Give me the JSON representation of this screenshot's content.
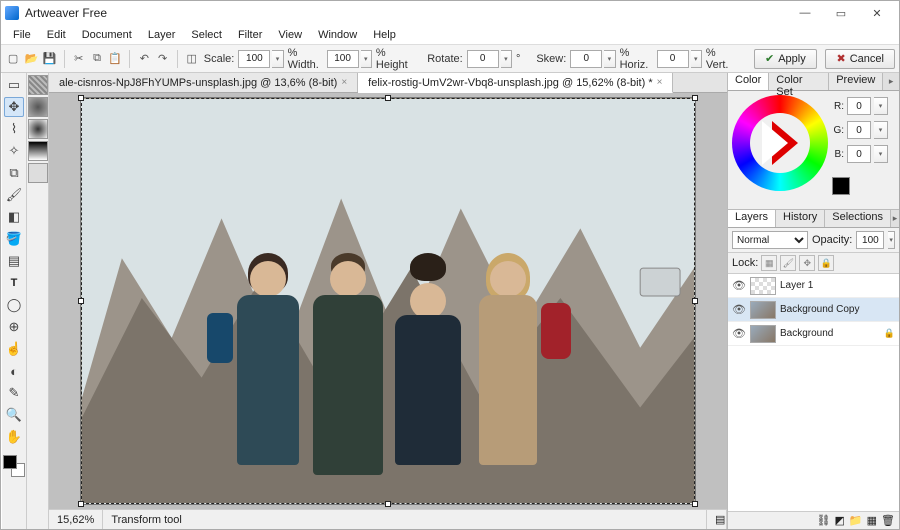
{
  "app": {
    "title": "Artweaver Free"
  },
  "menu": [
    "File",
    "Edit",
    "Document",
    "Layer",
    "Select",
    "Filter",
    "View",
    "Window",
    "Help"
  ],
  "toolbar": {
    "scale_label": "Scale:",
    "scale_value": "100",
    "width_label": "% Width.",
    "width_value": "100",
    "height_label": "% Height",
    "rotate_label": "Rotate:",
    "rotate_value": "0",
    "rotate_unit": "°",
    "skew_label": "Skew:",
    "skew_h": "0",
    "horiz_label": "% Horiz.",
    "skew_v": "0",
    "vert_label": "% Vert.",
    "apply": "Apply",
    "cancel": "Cancel"
  },
  "tabs": [
    {
      "label": "ale-cisnros-NpJ8FhYUMPs-unsplash.jpg @ 13,6% (8-bit)",
      "active": false
    },
    {
      "label": "felix-rostig-UmV2wr-Vbq8-unsplash.jpg @ 15,62% (8-bit) *",
      "active": true
    }
  ],
  "status": {
    "zoom": "15,62%",
    "tool": "Transform tool"
  },
  "color": {
    "tabs": [
      "Color",
      "Color Set",
      "Preview"
    ],
    "r": "0",
    "g": "0",
    "b": "0"
  },
  "layers": {
    "tabs": [
      "Layers",
      "History",
      "Selections"
    ],
    "blend": "Normal",
    "opacity_label": "Opacity:",
    "opacity": "100",
    "lock_label": "Lock:",
    "items": [
      {
        "name": "Layer 1",
        "visible": true,
        "blank": true,
        "selected": false,
        "locked": false
      },
      {
        "name": "Background Copy",
        "visible": true,
        "blank": false,
        "selected": true,
        "locked": false
      },
      {
        "name": "Background",
        "visible": true,
        "blank": false,
        "selected": false,
        "locked": true
      }
    ]
  },
  "tools_left": [
    "rect-select",
    "lasso",
    "wand",
    "crop",
    "move",
    "brush",
    "pencil",
    "eraser",
    "bucket",
    "gradient",
    "text",
    "shape",
    "clone",
    "smudge",
    "dodge",
    "eyedropper",
    "zoom",
    "hand"
  ],
  "dock_thumbs": [
    "texture-a",
    "texture-b",
    "texture-c",
    "gradient-a"
  ]
}
